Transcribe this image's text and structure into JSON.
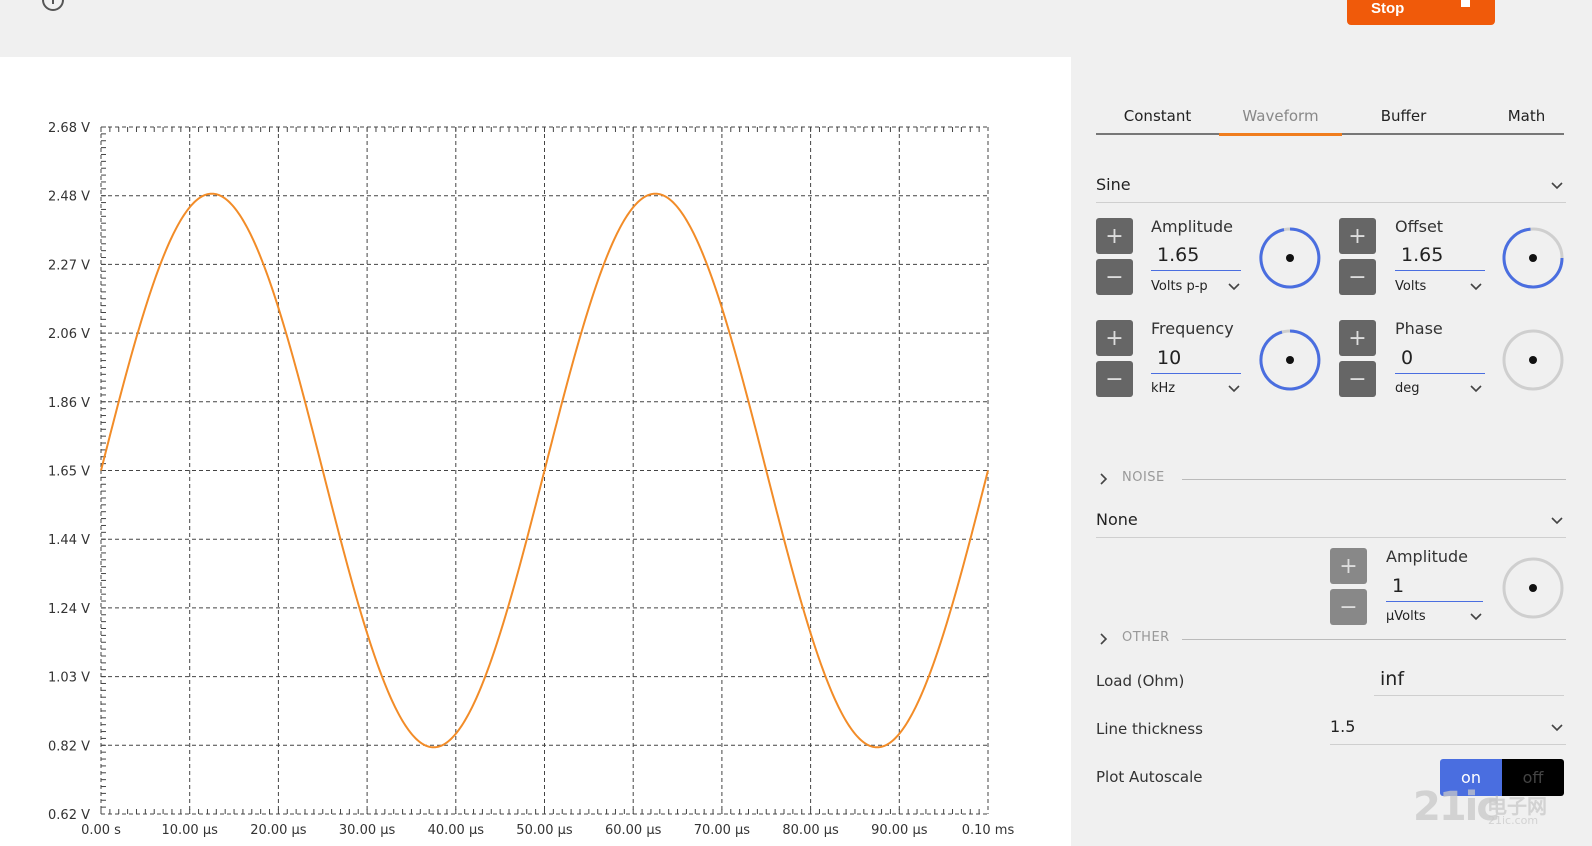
{
  "stop_button": {
    "label": "Stop"
  },
  "chart_data": {
    "type": "line",
    "title": "",
    "xlabel": "",
    "ylabel": "",
    "x_tick_labels": [
      "0.00 s",
      "10.00 µs",
      "20.00 µs",
      "30.00 µs",
      "40.00 µs",
      "50.00 µs",
      "60.00 µs",
      "70.00 µs",
      "80.00 µs",
      "90.00 µs",
      "0.10 ms"
    ],
    "y_tick_labels": [
      "2.68 V",
      "2.48 V",
      "2.27 V",
      "2.06 V",
      "1.86 V",
      "1.65 V",
      "1.44 V",
      "1.24 V",
      "1.03 V",
      "0.82 V",
      "0.62 V"
    ],
    "xlim_us": [
      0,
      100
    ],
    "ylim_v": [
      0.62,
      2.68
    ],
    "grid": true,
    "series": [
      {
        "color": "#f28c28",
        "waveform": "sine",
        "offset_v": 1.65,
        "peak_v": 2.48,
        "trough_v": 0.82,
        "frequency_khz": 20,
        "phase_deg": 0
      }
    ]
  },
  "panel": {
    "tabs": [
      {
        "label": "Constant",
        "active": false
      },
      {
        "label": "Waveform",
        "active": true
      },
      {
        "label": "Buffer",
        "active": false
      },
      {
        "label": "Math",
        "active": false
      }
    ],
    "waveform_type": "Sine",
    "amplitude": {
      "label": "Amplitude",
      "value": "1.65",
      "unit": "Volts p-p"
    },
    "offset": {
      "label": "Offset",
      "value": "1.65",
      "unit": "Volts"
    },
    "frequency": {
      "label": "Frequency",
      "value": "10",
      "unit": "kHz"
    },
    "phase": {
      "label": "Phase",
      "value": "0",
      "unit": "deg"
    },
    "noise_section": "NOISE",
    "noise_type": "None",
    "noise_amplitude": {
      "label": "Amplitude",
      "value": "1",
      "unit": "µVolts"
    },
    "other_section": "OTHER",
    "load": {
      "label": "Load (Ohm)",
      "value": "inf"
    },
    "line_thickness": {
      "label": "Line thickness",
      "value": "1.5"
    },
    "plot_autoscale": {
      "label": "Plot Autoscale",
      "on_label": "on",
      "off_label": "off",
      "state": "on"
    },
    "plus_symbol": "+",
    "minus_symbol": "−"
  },
  "watermark": {
    "text": "21ic",
    "cn": "电子网",
    "sub": "21ic.com"
  },
  "colors": {
    "accent": "#f05a0a",
    "trace": "#f28c28",
    "knob_blue": "#4a6ee0"
  }
}
